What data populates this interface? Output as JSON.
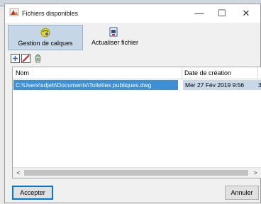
{
  "window": {
    "title": "Fichiers disponibles",
    "minimize_glyph": "—",
    "maximize_glyph": "☐",
    "close_glyph": "✕"
  },
  "toolbar": {
    "layers_label": "Gestion de calques",
    "refresh_label": "Actualiser fichier"
  },
  "icons": {
    "title": "autocad-app-icon",
    "layers": "layers-icon",
    "refresh": "refresh-file-icon",
    "add": "add-icon",
    "remove": "remove-icon",
    "recycle": "recycle-icon"
  },
  "table": {
    "columns": [
      "Nom",
      "Date de création"
    ],
    "rows": [
      {
        "path": "C:\\Users\\sdjeb\\Documents\\Toilettes publiques.dwg",
        "date": "Mer 27 Fév 2019  9:56",
        "extra": "3"
      }
    ]
  },
  "scroll": {
    "left": "<",
    "right": ">"
  },
  "buttons": {
    "accept": "Accepter",
    "cancel": "Annuler"
  },
  "colors": {
    "selection": "#3d8fd6",
    "selection_alt": "#c8d8e8",
    "active_tool": "#c5d7e6"
  }
}
